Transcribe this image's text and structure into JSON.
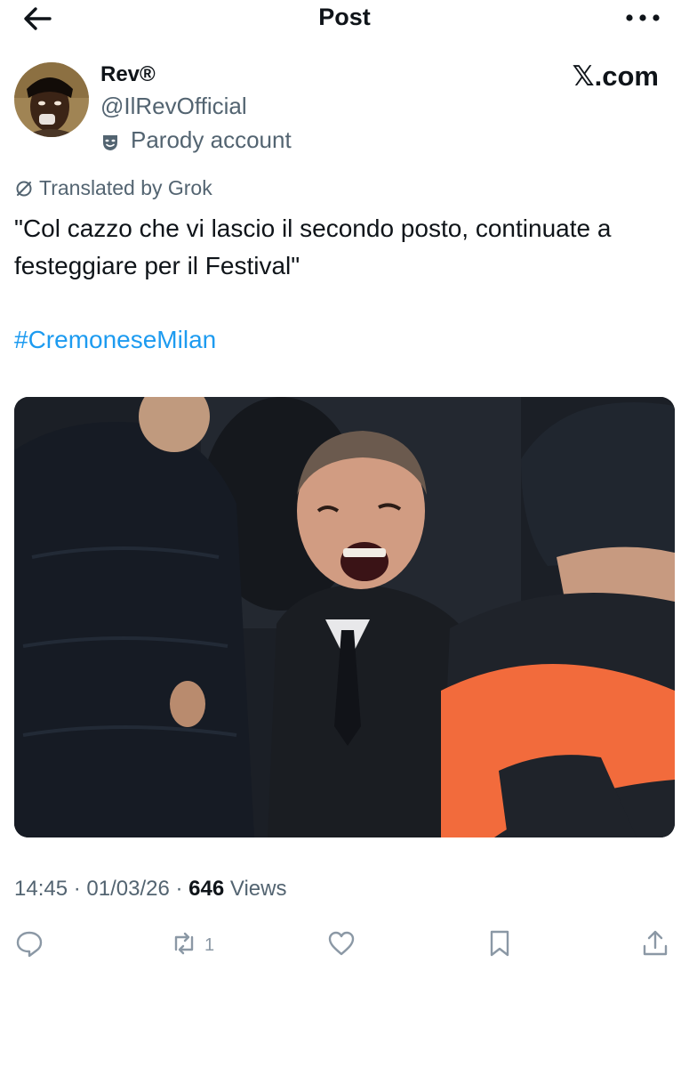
{
  "header": {
    "title": "Post"
  },
  "author": {
    "display_name": "Rev®",
    "handle": "@IlRevOfficial",
    "parody_label": "Parody account"
  },
  "brand": "𝕏.com",
  "post": {
    "translated_label": "Translated by Grok",
    "text": "\"Col cazzo che vi lascio il secondo posto, continuate a festeggiare per il Festival\"",
    "hashtag": "#CremoneseMilan"
  },
  "meta": {
    "time": "14:45",
    "date": "01/03/26",
    "separator": "·",
    "views_count": "646",
    "views_label": "Views"
  },
  "actions": {
    "reply_count": "",
    "retweet_count": "1",
    "like_count": "",
    "icons": [
      "reply-icon",
      "retweet-icon",
      "like-icon",
      "bookmark-icon",
      "share-icon"
    ]
  },
  "colors": {
    "link": "#1d9bf0",
    "secondary_text": "#536471",
    "action_icon": "#8b98a5"
  }
}
